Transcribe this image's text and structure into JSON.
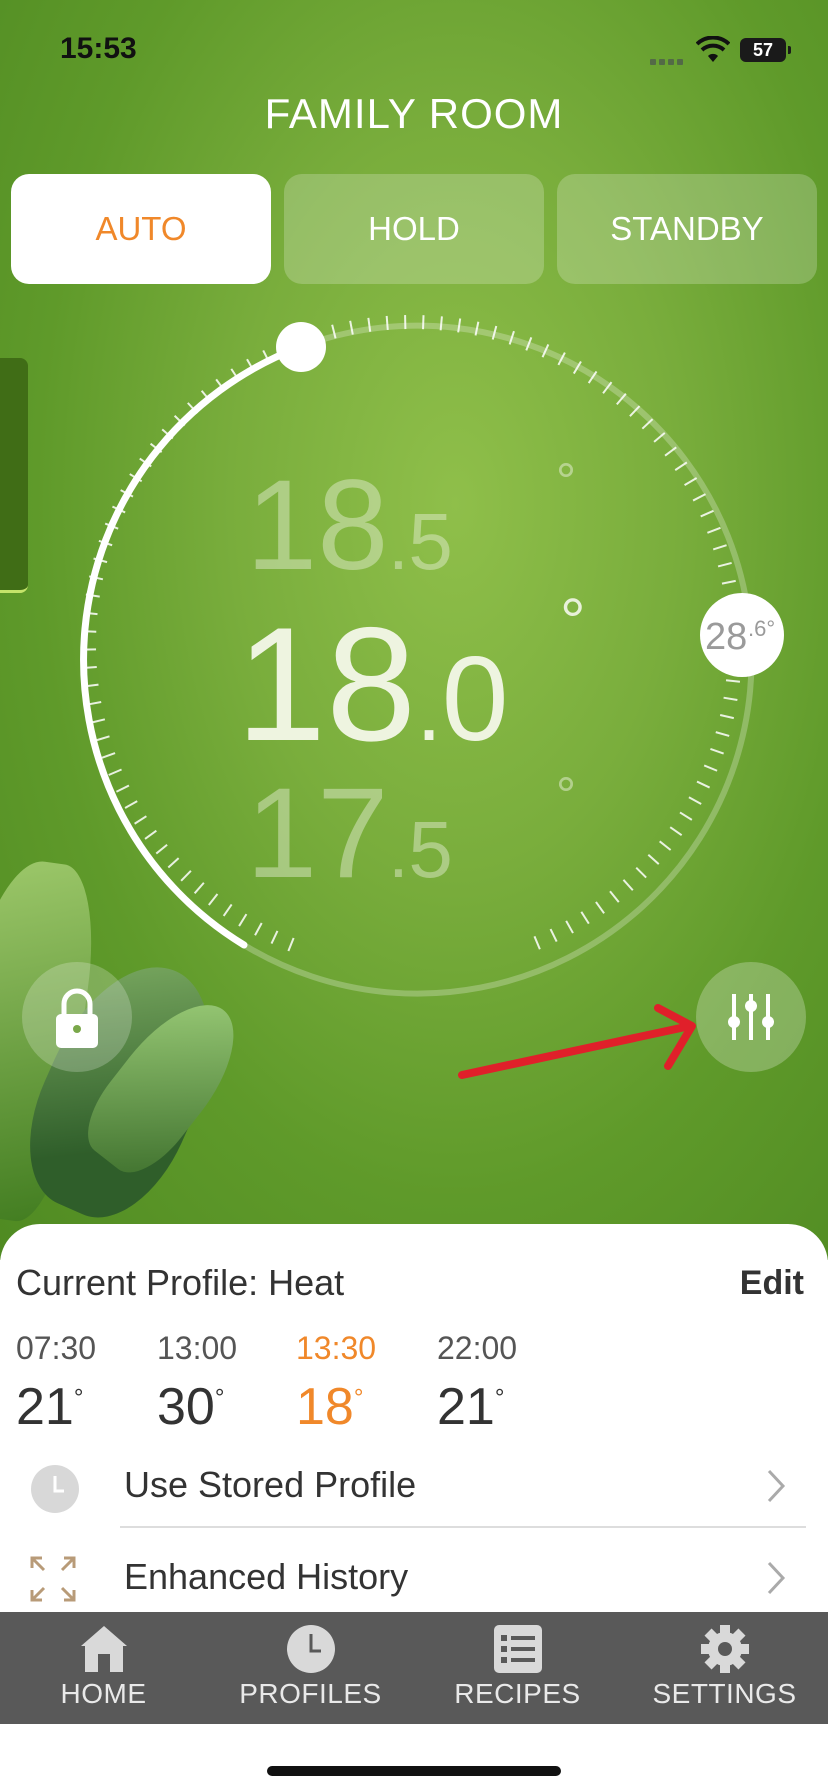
{
  "status_bar": {
    "time": "15:53",
    "battery": "57"
  },
  "room": {
    "title": "FAMILY ROOM"
  },
  "modes": [
    {
      "label": "AUTO",
      "active": true
    },
    {
      "label": "HOLD",
      "active": false
    },
    {
      "label": "STANDBY",
      "active": false
    }
  ],
  "dial": {
    "upper_int": "18",
    "upper_dec": "5",
    "current_int": "18",
    "current_dec": "0",
    "lower_int": "17",
    "lower_dec": "5",
    "degree": "°",
    "measured": "28",
    "measured_dec": ".6°"
  },
  "profile": {
    "title": "Current Profile: Heat",
    "edit_label": "Edit",
    "slots": [
      {
        "time": "07:30",
        "temp": "21",
        "current": false
      },
      {
        "time": "13:00",
        "temp": "30",
        "current": false
      },
      {
        "time": "13:30",
        "temp": "18",
        "current": true
      },
      {
        "time": "22:00",
        "temp": "21",
        "current": false
      }
    ],
    "rows": [
      {
        "label": "Use Stored Profile",
        "icon": "clock-icon"
      },
      {
        "label": "Enhanced History",
        "icon": "expand-icon"
      }
    ]
  },
  "tabbar": {
    "items": [
      {
        "label": "HOME",
        "icon": "home-icon"
      },
      {
        "label": "PROFILES",
        "icon": "clock-icon"
      },
      {
        "label": "RECIPES",
        "icon": "list-icon"
      },
      {
        "label": "SETTINGS",
        "icon": "gear-icon"
      }
    ]
  },
  "colors": {
    "accent": "#f0882a",
    "tabbar": "#595959",
    "background_green": "#79ad3c",
    "annotation_red": "#e0202a"
  }
}
